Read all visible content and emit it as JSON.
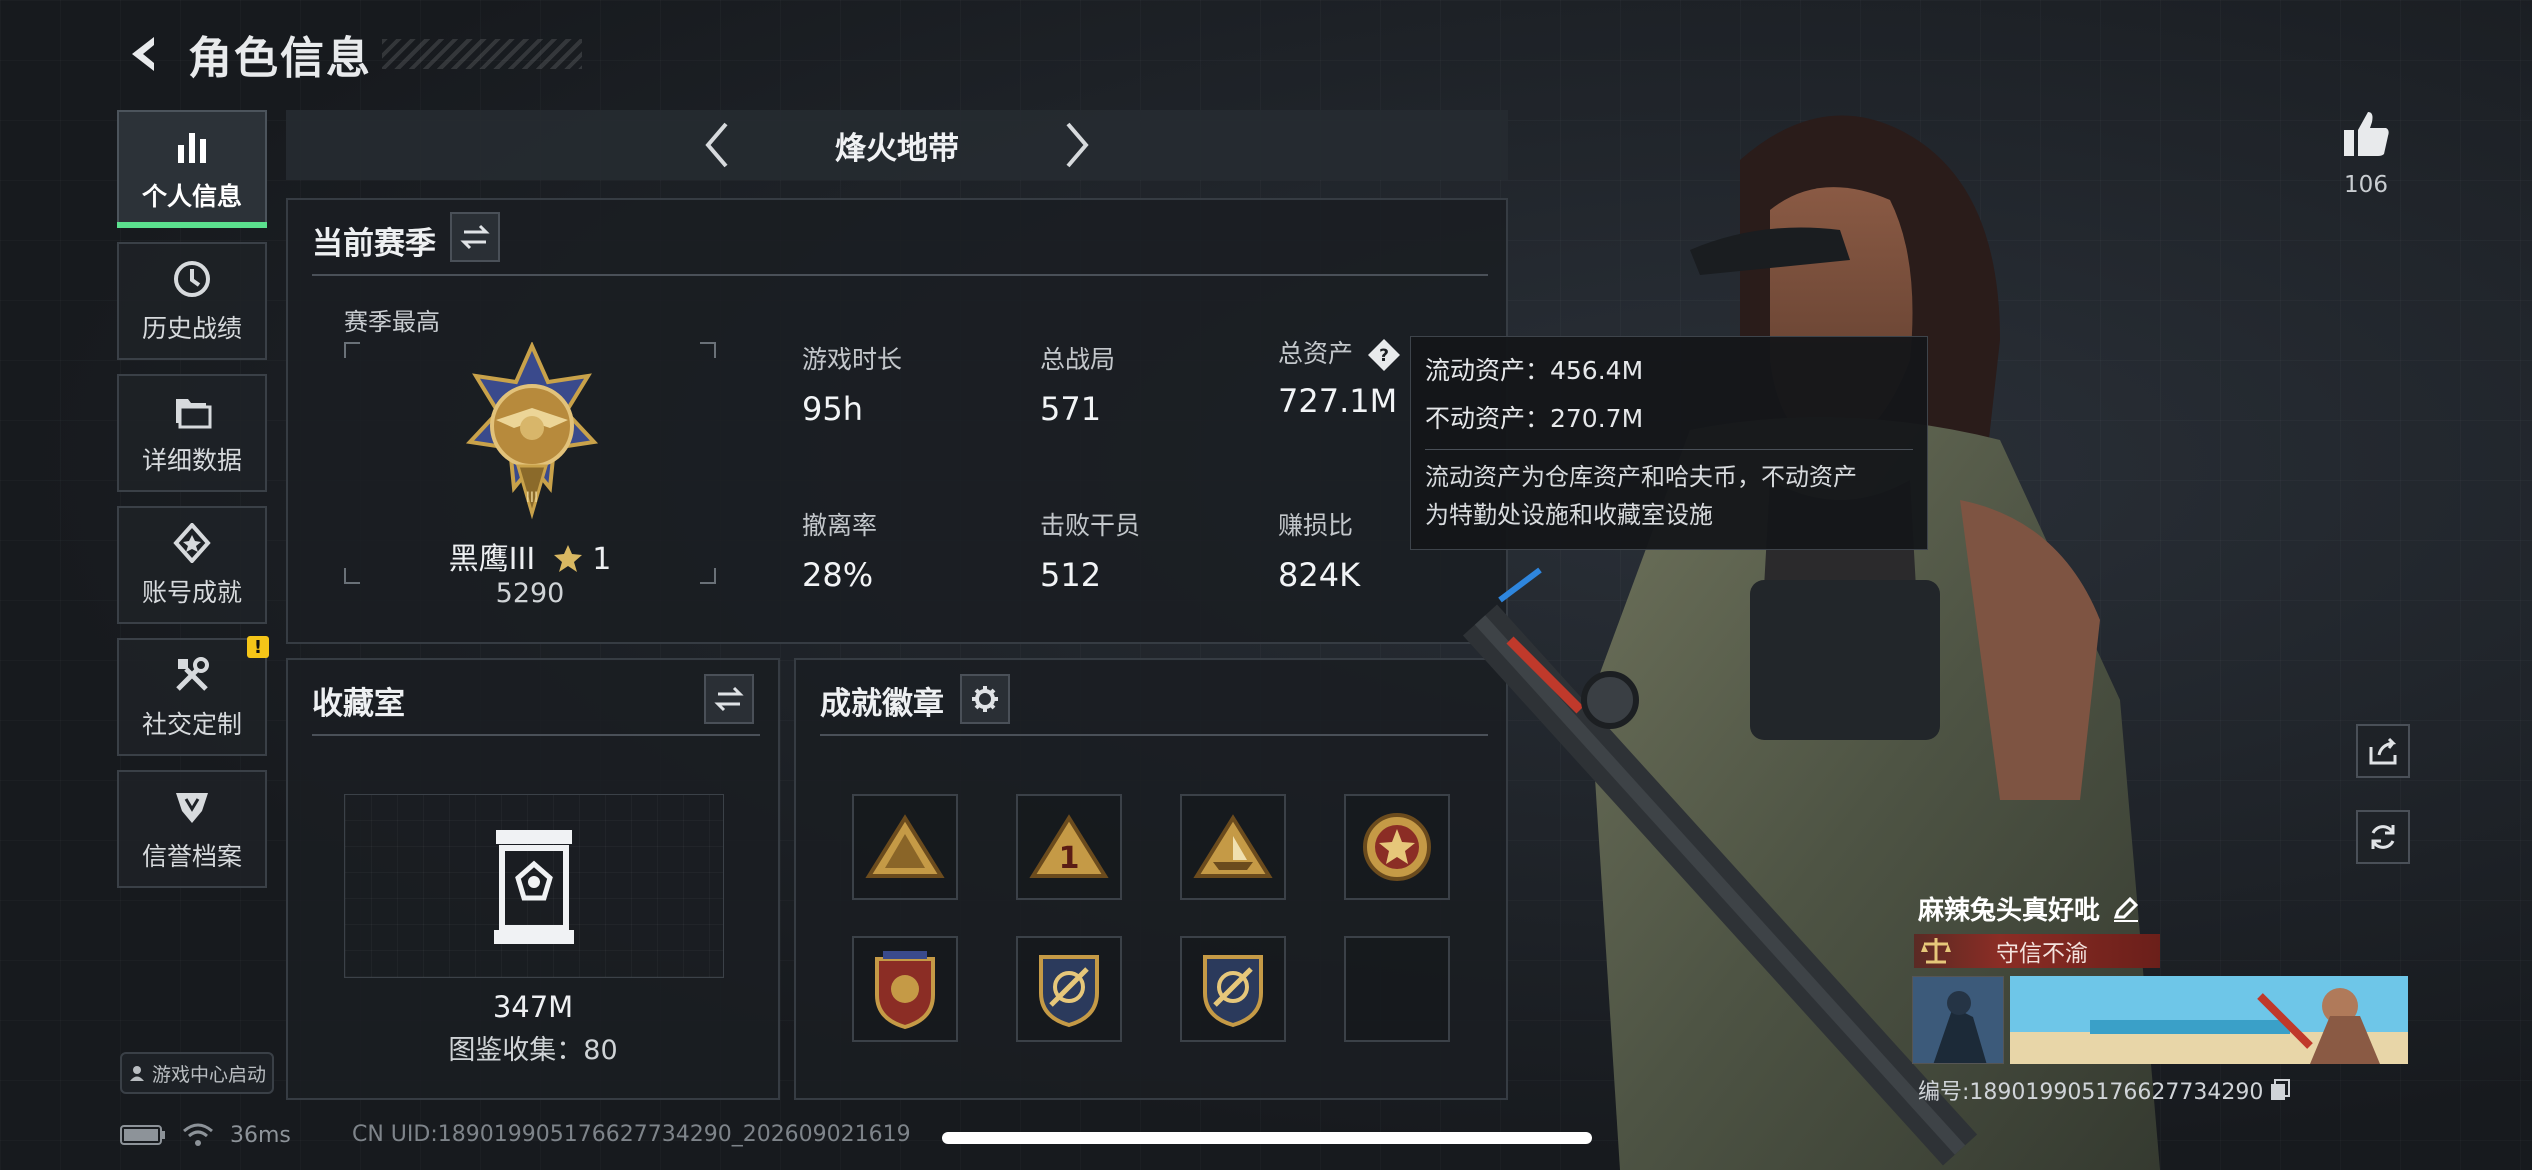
{
  "header": {
    "title": "角色信息"
  },
  "sidebar": {
    "items": [
      {
        "label": "个人信息",
        "icon": "bar-chart-icon",
        "active": true
      },
      {
        "label": "历史战绩",
        "icon": "clock-icon"
      },
      {
        "label": "详细数据",
        "icon": "folder-icon"
      },
      {
        "label": "账号成就",
        "icon": "achievement-icon"
      },
      {
        "label": "社交定制",
        "icon": "tools-icon",
        "badge": "!"
      },
      {
        "label": "信誉档案",
        "icon": "shield-icon"
      }
    ],
    "game_center": "游戏中心启动"
  },
  "mode": {
    "title": "烽火地带"
  },
  "season": {
    "title": "当前赛季",
    "subtitle": "赛季最高",
    "rank_name": "黑鹰III",
    "rank_stars": "1",
    "rank_score": "5290",
    "stats": [
      {
        "label": "游戏时长",
        "value": "95h"
      },
      {
        "label": "总战局",
        "value": "571"
      },
      {
        "label": "总资产",
        "value": "727.1M",
        "help": true
      },
      {
        "label": "撤离率",
        "value": "28%"
      },
      {
        "label": "击败干员",
        "value": "512"
      },
      {
        "label": "赚损比",
        "value": "824K"
      }
    ]
  },
  "tooltip": {
    "liquid": "流动资产：456.4M",
    "fixed": "不动资产：270.7M",
    "desc1": "流动资产为仓库资产和哈夫币，不动资产",
    "desc2": "为特勤处设施和收藏室设施"
  },
  "collection": {
    "title": "收藏室",
    "value": "347M",
    "count": "图鉴收集：80"
  },
  "badges": {
    "title": "成就徽章"
  },
  "profile": {
    "likes": "106",
    "name": "麻辣兔头真好吡",
    "trust": "守信不渝",
    "id": "编号:1890199051766277342​90"
  },
  "status": {
    "ping": "36ms",
    "uid": "CN UID:18901990517662773429​0_202609021619"
  },
  "colors": {
    "accent": "#5be08e",
    "warn": "#f5c518",
    "trust": "#8b2d25"
  }
}
